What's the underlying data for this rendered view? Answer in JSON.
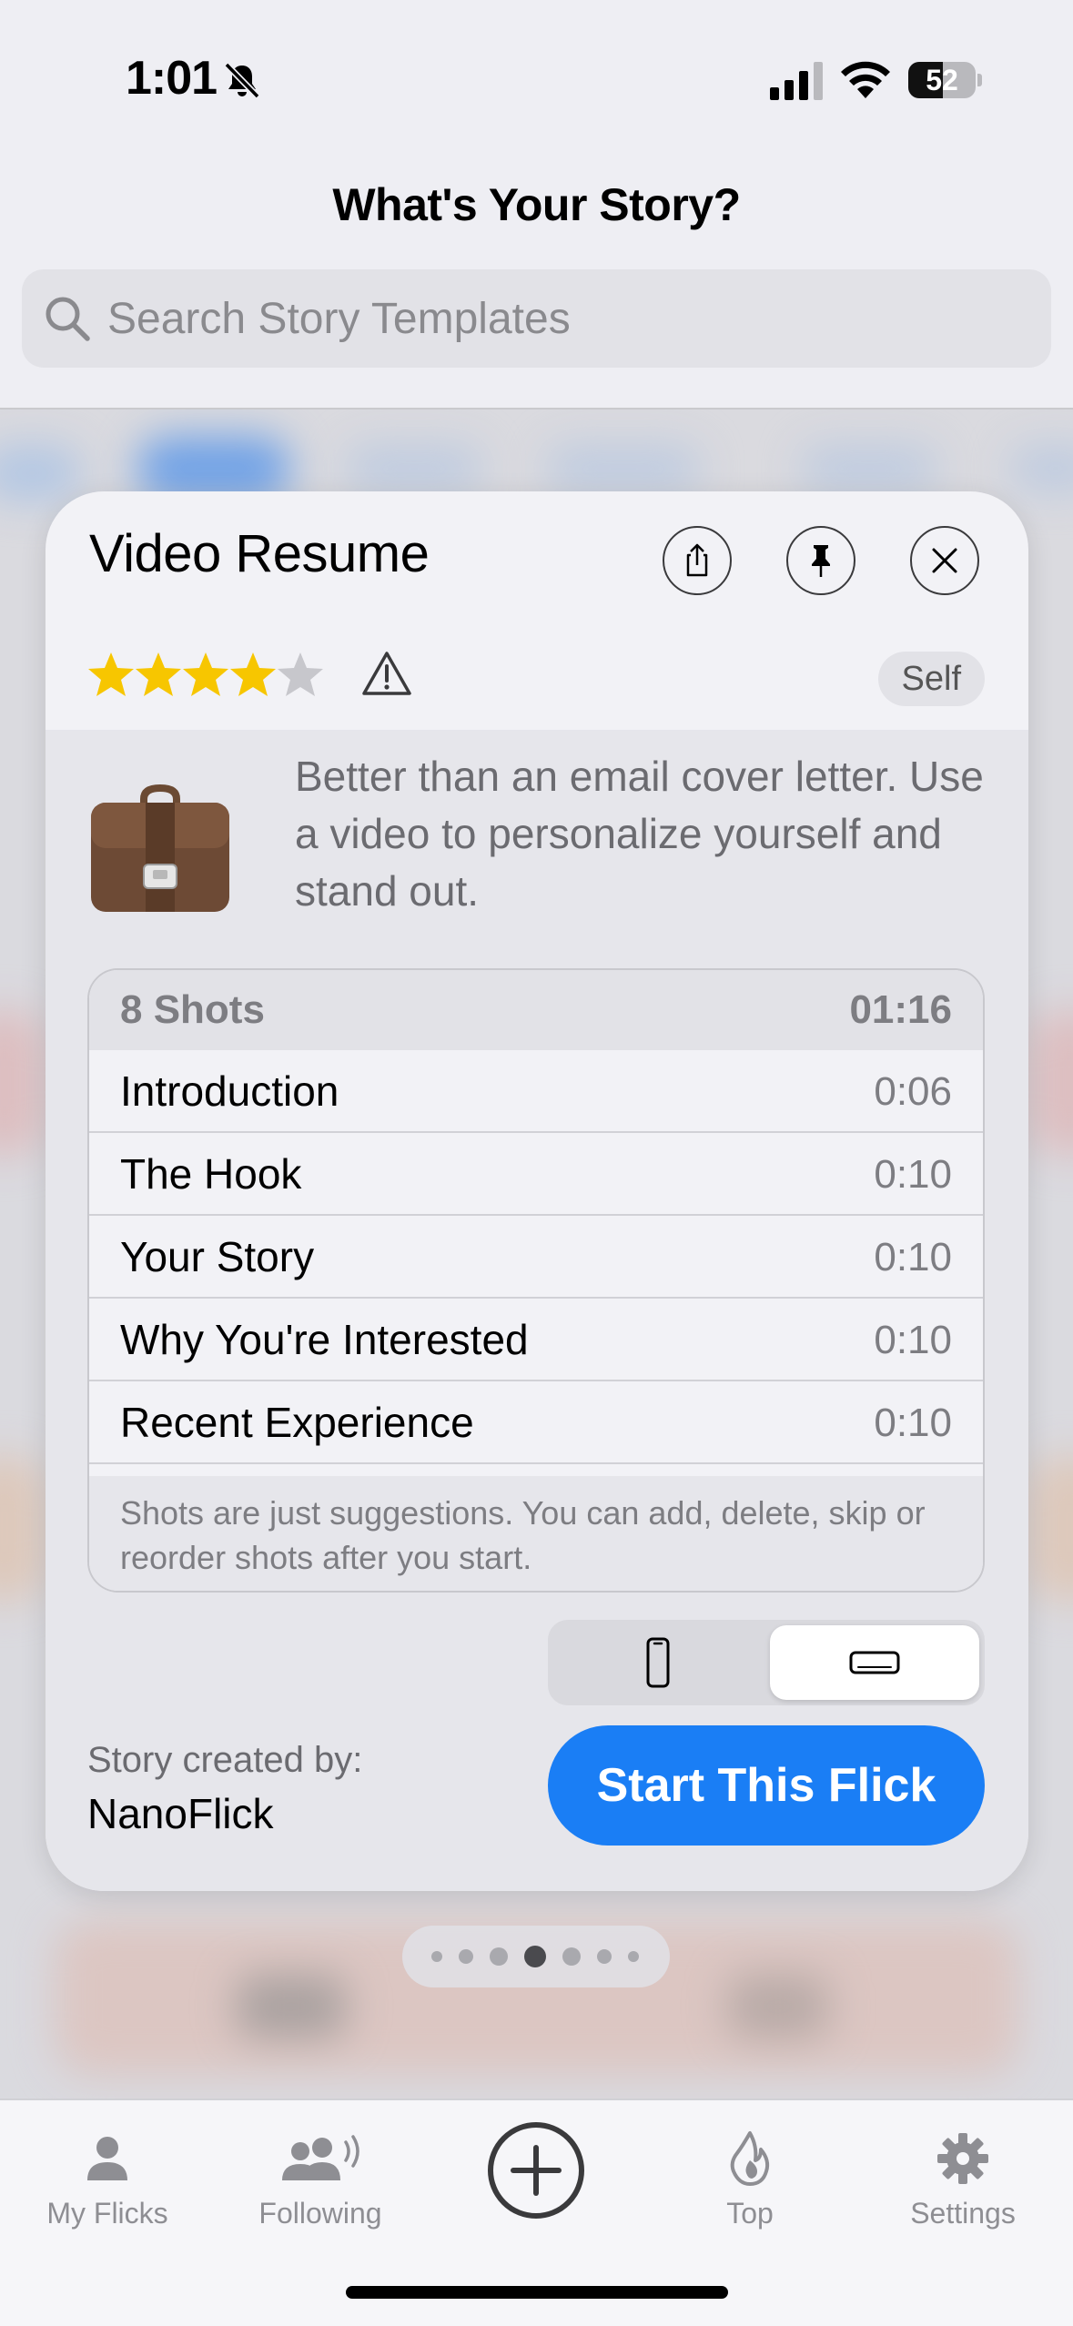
{
  "status_bar": {
    "time": "1:01",
    "battery_level": 52,
    "battery_text": "52"
  },
  "header": {
    "title": "What's Your Story?",
    "search_placeholder": "Search Story Templates"
  },
  "card": {
    "title": "Video Resume",
    "rating": 4,
    "rating_max": 5,
    "badge": "Self",
    "icon": "briefcase-icon",
    "description": "Better than an email cover letter. Use a video to personalize yourself and stand out.",
    "shots": {
      "count_label": "8 Shots",
      "total_duration": "01:16",
      "items": [
        {
          "name": "Introduction",
          "duration": "0:06"
        },
        {
          "name": "The Hook",
          "duration": "0:10"
        },
        {
          "name": "Your Story",
          "duration": "0:10"
        },
        {
          "name": "Why You're Interested",
          "duration": "0:10"
        },
        {
          "name": "Recent Experience",
          "duration": "0:10"
        }
      ],
      "note": "Shots are just suggestions. You can add, delete, skip or reorder shots after you start."
    },
    "orientation": {
      "options": [
        "portrait",
        "landscape"
      ],
      "selected": "landscape"
    },
    "creator_label": "Story created by:",
    "creator_name": "NanoFlick",
    "start_button": "Start This Flick"
  },
  "pager": {
    "total": 7,
    "active_index": 3
  },
  "tab_bar": {
    "items": [
      {
        "label": "My Flicks",
        "icon": "person-icon"
      },
      {
        "label": "Following",
        "icon": "people-icon"
      },
      {
        "label": "",
        "icon": "add-circle-icon"
      },
      {
        "label": "Top",
        "icon": "flame-icon"
      },
      {
        "label": "Settings",
        "icon": "gear-icon"
      }
    ]
  },
  "colors": {
    "accent": "#1a7ef5",
    "star": "#f7c600",
    "star_empty": "#c7c7cc"
  }
}
